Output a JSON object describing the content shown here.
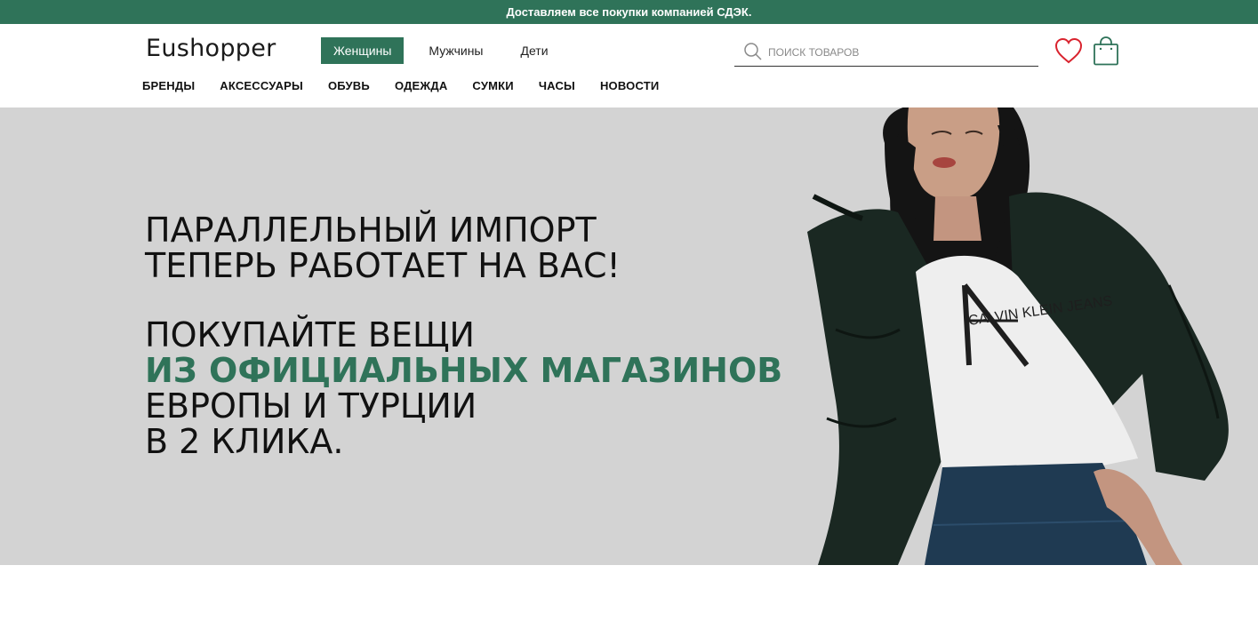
{
  "topbar": {
    "text": "Доставляем все покупки компанией СДЭК."
  },
  "header": {
    "logo": "Eushopper",
    "gender_tabs": [
      {
        "label": "Женщины",
        "active": true
      },
      {
        "label": "Мужчины",
        "active": false
      },
      {
        "label": "Дети",
        "active": false
      }
    ],
    "search": {
      "placeholder": "ПОИСК ТОВАРОВ",
      "value": ""
    },
    "icons": {
      "search": "search-icon",
      "wishlist": "heart-icon",
      "cart": "shopping-bag-icon"
    }
  },
  "categories": [
    "БРЕНДЫ",
    "АКСЕССУАРЫ",
    "ОБУВЬ",
    "ОДЕЖДА",
    "СУМКИ",
    "ЧАСЫ",
    "НОВОСТИ"
  ],
  "hero": {
    "line1": "ПАРАЛЛЕЛЬНЫЙ ИМПОРТ",
    "line2": "ТЕПЕРЬ РАБОТАЕТ НА ВАС!",
    "line3": "ПОКУПАЙТЕ ВЕЩИ",
    "line4_accent": "ИЗ ОФИЦИАЛЬНЫХ МАГАЗИНОВ",
    "line5": "ЕВРОПЫ И ТУРЦИИ",
    "line6": "В 2 КЛИКА.",
    "shirt_print": "CALVIN KLEIN JEANS"
  },
  "colors": {
    "brand_green": "#2f7359",
    "hero_bg": "#d3d3d3",
    "heart_red": "#d9232e"
  }
}
